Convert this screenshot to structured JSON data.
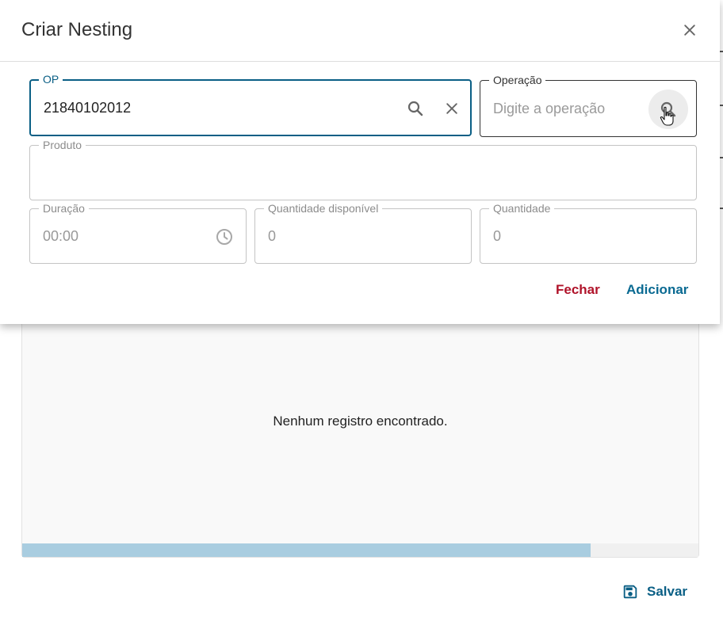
{
  "dialog": {
    "title": "Criar Nesting",
    "fields": {
      "op": {
        "label": "OP",
        "value": "21840102012"
      },
      "operacao": {
        "label": "Operação",
        "placeholder": "Digite a operação"
      },
      "produto": {
        "label": "Produto",
        "value": ""
      },
      "duracao": {
        "label": "Duração",
        "value": "00:00"
      },
      "quantidade_disponivel": {
        "label": "Quantidade disponível",
        "value": "0"
      },
      "quantidade": {
        "label": "Quantidade",
        "value": "0"
      }
    },
    "actions": {
      "close_label": "Fechar",
      "add_label": "Adicionar"
    }
  },
  "table": {
    "empty_message": "Nenhum registro encontrado.",
    "scroll_fraction": 0.84
  },
  "footer": {
    "save_label": "Salvar"
  },
  "colors": {
    "accent": "#0a5f85",
    "danger": "#b0132a",
    "scroll_thumb": "#a9cde0"
  },
  "icons": [
    "close-icon",
    "search-icon",
    "clear-icon",
    "clock-icon",
    "save-icon",
    "hand-cursor-icon"
  ]
}
